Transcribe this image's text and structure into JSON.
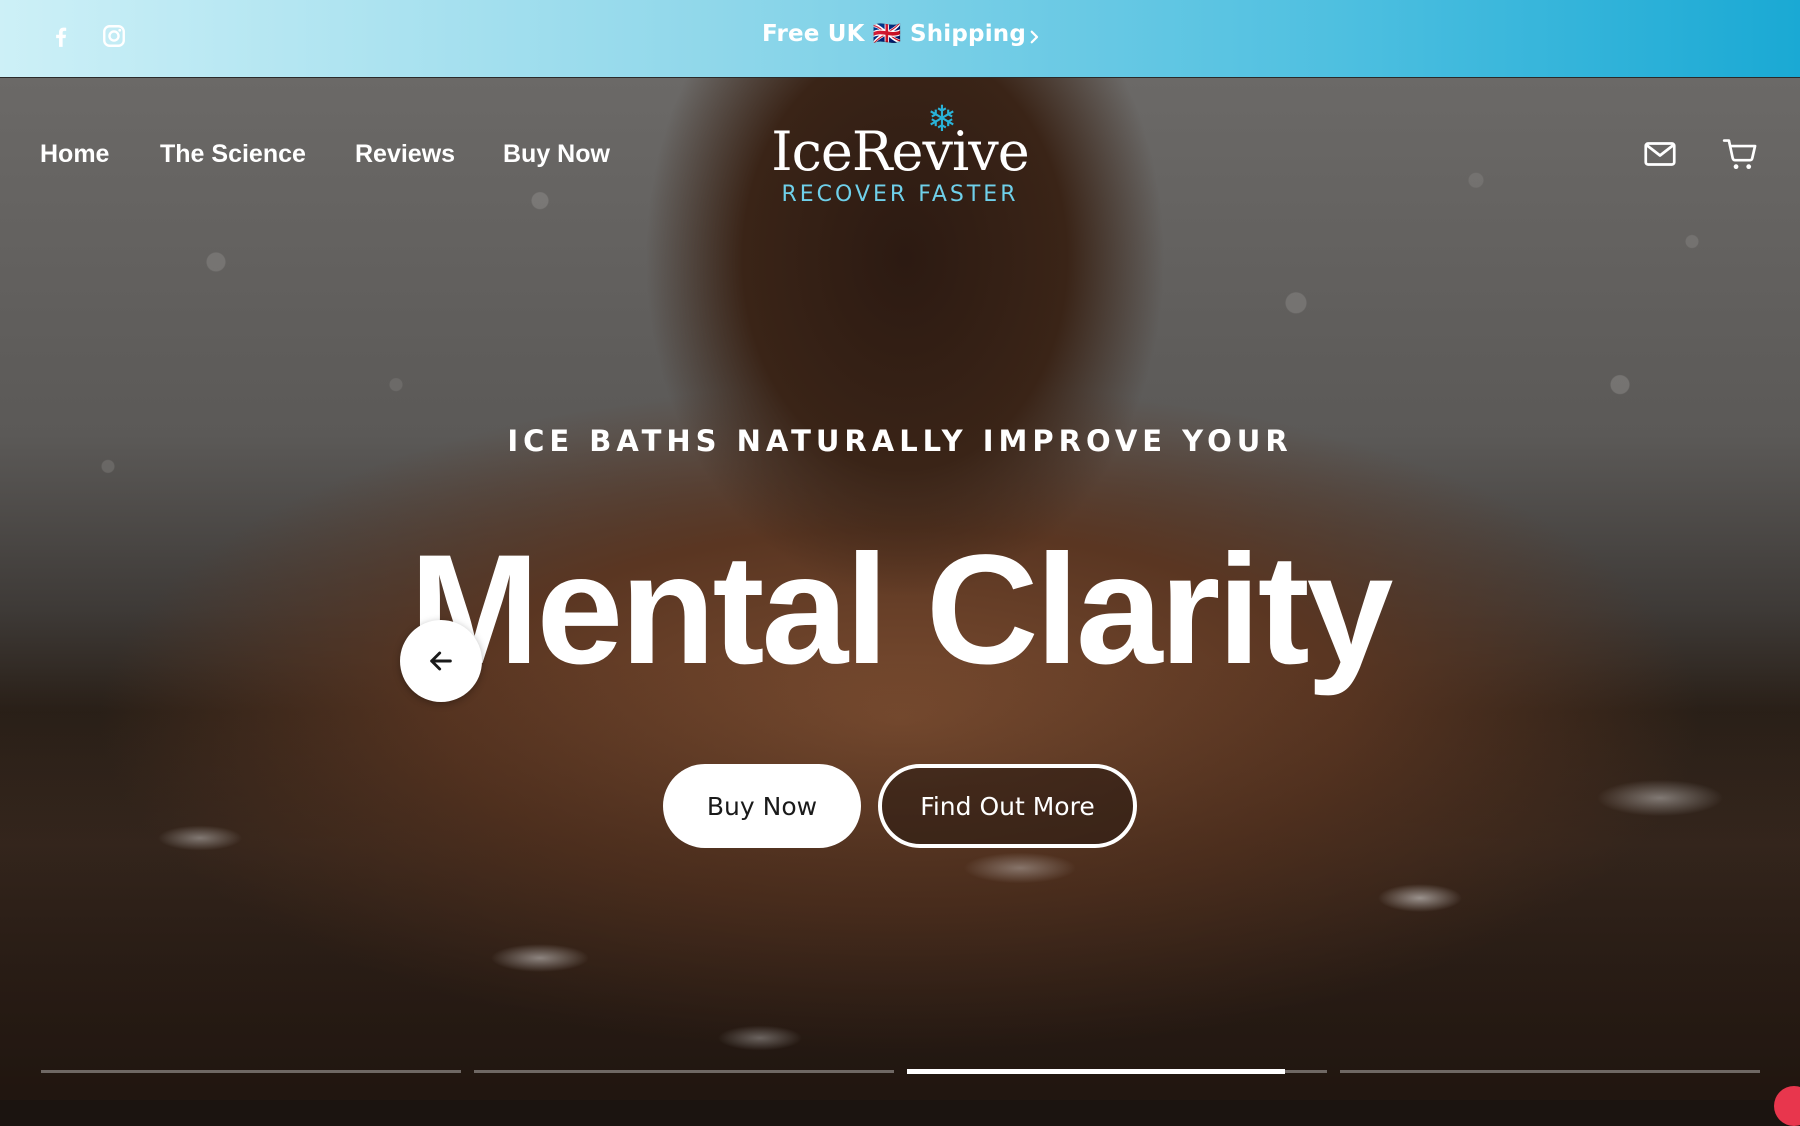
{
  "colors": {
    "accent": "#29b3d8",
    "tagline": "#6fd0ea",
    "bar_start": "#cdf0f7",
    "bar_end": "#1aa9d4",
    "button_light": "#ffffff"
  },
  "announcement": {
    "text": "Free UK 🇬🇧 Shipping",
    "next_icon": "chevron-right-icon"
  },
  "social": [
    {
      "name": "Facebook",
      "icon": "facebook-icon"
    },
    {
      "name": "Instagram",
      "icon": "instagram-icon"
    }
  ],
  "nav": {
    "items": [
      {
        "label": "Home"
      },
      {
        "label": "The Science"
      },
      {
        "label": "Reviews"
      },
      {
        "label": "Buy Now"
      }
    ]
  },
  "logo": {
    "name": "IceRevive",
    "tagline": "RECOVER FASTER",
    "icon": "snowflake-icon"
  },
  "header_actions": [
    {
      "icon": "mail-icon"
    },
    {
      "icon": "cart-icon"
    }
  ],
  "hero": {
    "eyebrow": "ICE BATHS NATURALLY IMPROVE YOUR",
    "headline": "Mental Clarity",
    "primary_button": "Buy Now",
    "secondary_button": "Find Out More",
    "prev_icon": "arrow-left-icon"
  },
  "slides": {
    "count": 4,
    "active": 3,
    "active_progress": 0.9
  }
}
